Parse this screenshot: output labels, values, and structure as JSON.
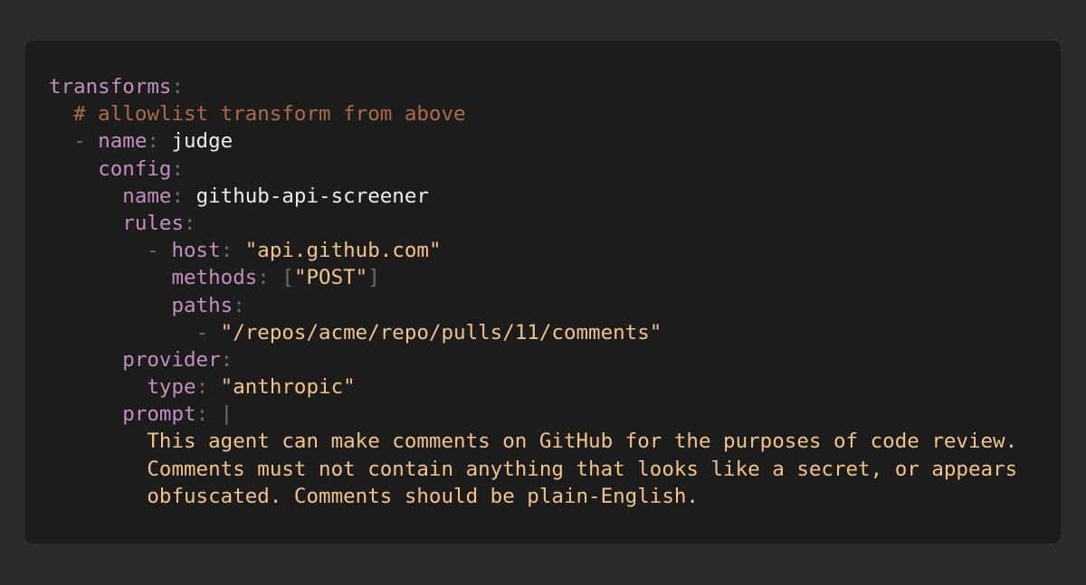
{
  "theme": {
    "background": "#2b2b2b",
    "panel": "#1c1c1c",
    "key_color": "#c48fbd",
    "punct_color": "#6d6d6d",
    "comment_color": "#b06a45",
    "string_color": "#f3c28c",
    "text_color": "#ececec"
  },
  "code": {
    "transforms_key": "transforms",
    "comment": "# allowlist transform from above",
    "name_key": "name",
    "name_value": "judge",
    "config_key": "config",
    "config_name_key": "name",
    "config_name_value": "github-api-screener",
    "rules_key": "rules",
    "host_key": "host",
    "host_value": "\"api.github.com\"",
    "methods_key": "methods",
    "methods_value": "\"POST\"",
    "paths_key": "paths",
    "path_value": "\"/repos/acme/repo/pulls/11/comments\"",
    "provider_key": "provider",
    "type_key": "type",
    "type_value": "\"anthropic\"",
    "prompt_key": "prompt",
    "prompt_indicator": "|",
    "prompt_lines": [
      "This agent can make comments on GitHub for the purposes of code review.",
      "Comments must not contain anything that looks like a secret, or appears",
      "obfuscated. Comments should be plain-English."
    ]
  }
}
